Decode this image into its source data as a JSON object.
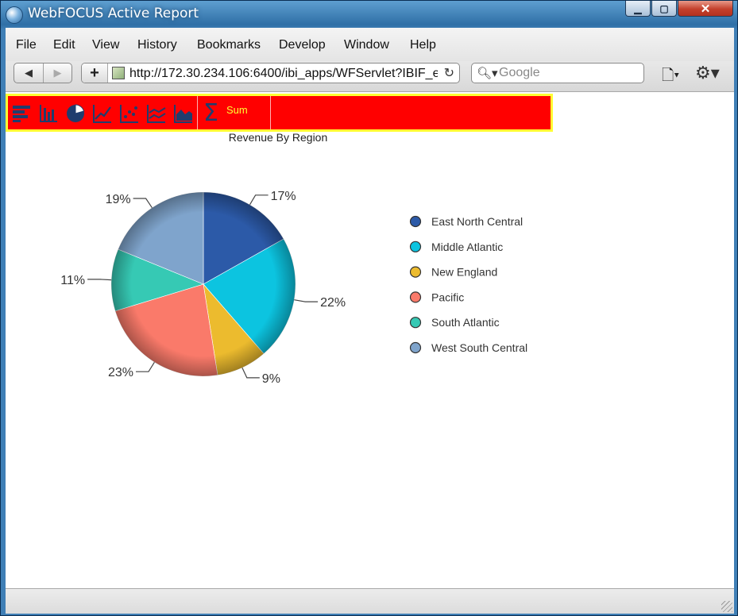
{
  "window": {
    "title": "WebFOCUS Active Report"
  },
  "menu": [
    "File",
    "Edit",
    "View",
    "History",
    "Bookmarks",
    "Develop",
    "Window",
    "Help"
  ],
  "nav": {
    "url": "http://172.30.234.106:6400/ibi_apps/WFServlet?IBIF_e",
    "search_placeholder": "Google"
  },
  "toolbar": {
    "icons": [
      "bar-chart-horizontal-icon",
      "bar-chart-icon",
      "pie-chart-icon",
      "line-chart-icon",
      "scatter-chart-icon",
      "multi-line-chart-icon",
      "area-chart-icon"
    ],
    "sum_symbol": "Σ",
    "sum_label": "Sum",
    "colors": {
      "background": "#ff0000",
      "border": "#ffff33",
      "icon": "#1f3d6e"
    }
  },
  "chart_data": {
    "type": "pie",
    "title": "Revenue By Region",
    "legend_position": "right",
    "slices": [
      {
        "label": "East North Central",
        "value": 17,
        "display": "17%",
        "color": "#2c5aa8"
      },
      {
        "label": "Middle Atlantic",
        "value": 22,
        "display": "22%",
        "color": "#0cc4e0"
      },
      {
        "label": "New England",
        "value": 9,
        "display": "9%",
        "color": "#ecbb2e"
      },
      {
        "label": "Pacific",
        "value": 23,
        "display": "23%",
        "color": "#fa7a6a"
      },
      {
        "label": "South Atlantic",
        "value": 11,
        "display": "11%",
        "color": "#36c9b4"
      },
      {
        "label": "West South Central",
        "value": 19,
        "display": "19%",
        "color": "#7fa4cc"
      }
    ]
  }
}
